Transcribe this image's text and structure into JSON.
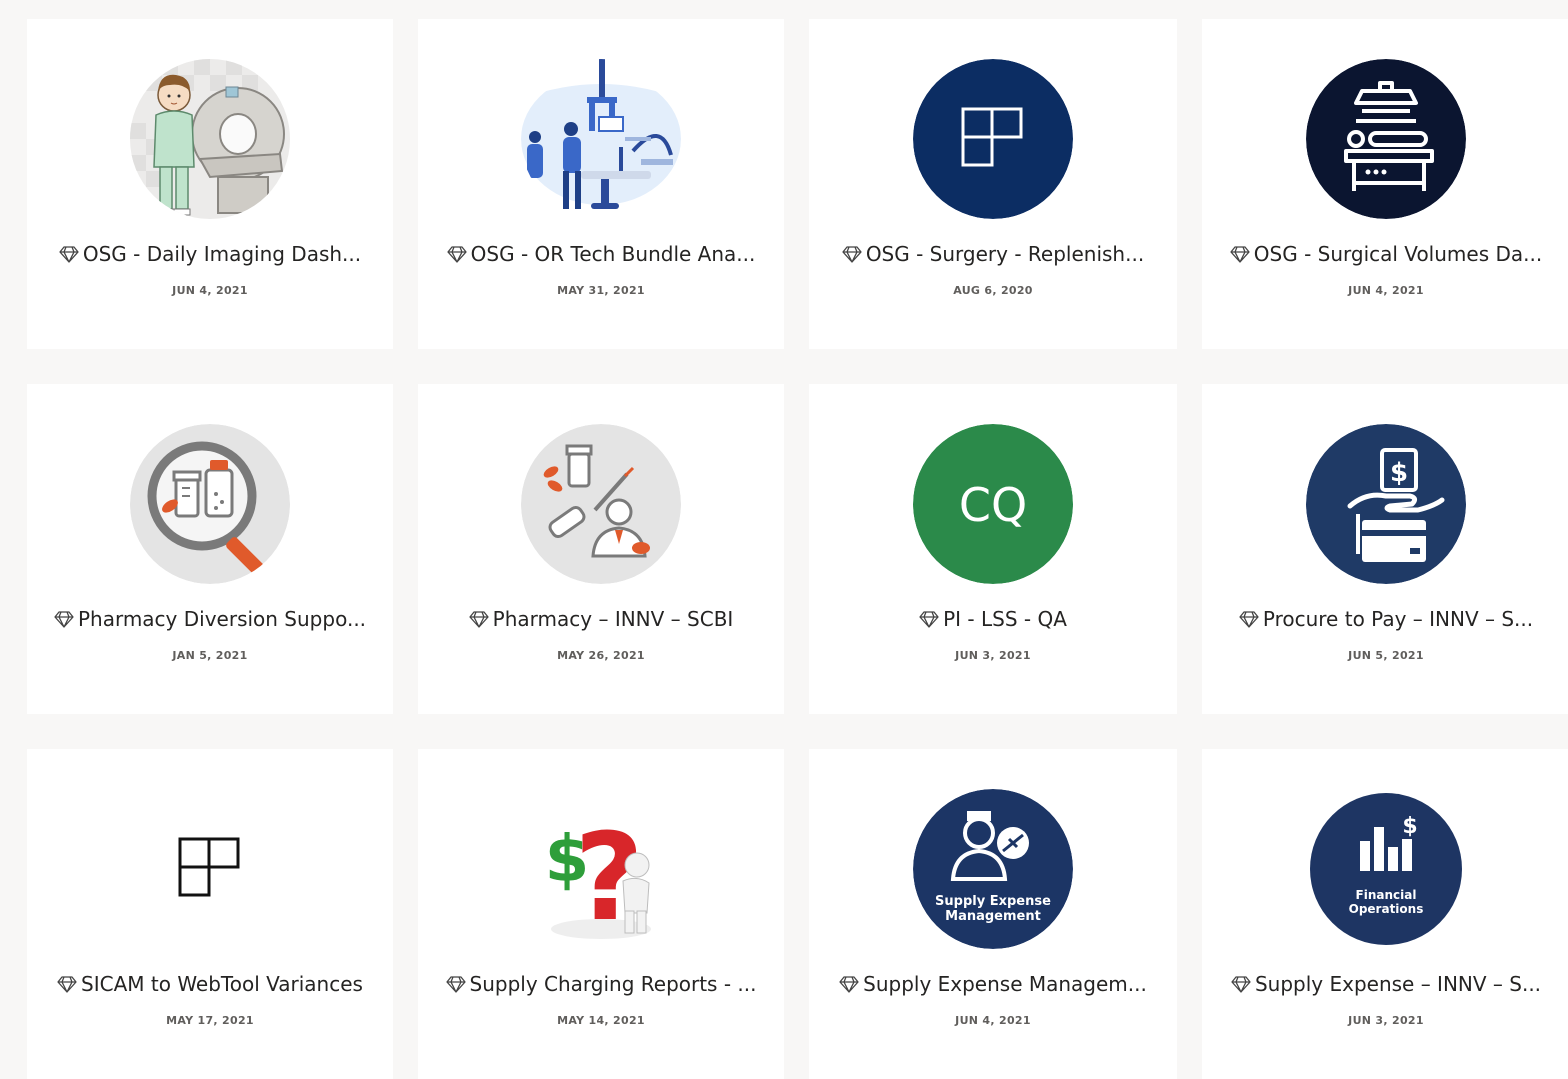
{
  "cards": [
    {
      "title": "OSG - Daily Imaging Dash...",
      "date": "JUN 4, 2021",
      "image": "ct-scanner-technician-illustration"
    },
    {
      "title": "OSG - OR Tech Bundle Ana...",
      "date": "MAY 31, 2021",
      "image": "operating-room-illustration"
    },
    {
      "title": "OSG - Surgery - Replenish...",
      "date": "AUG 6, 2020",
      "image": "app-grid-icon",
      "color": "#0c2d63"
    },
    {
      "title": "OSG - Surgical Volumes Da...",
      "date": "JUN 4, 2021",
      "image": "surgical-table-light-icon",
      "color": "#0b1530"
    },
    {
      "title": "Pharmacy Diversion Suppo...",
      "date": "JAN 5, 2021",
      "image": "magnifier-medication-icon"
    },
    {
      "title": "Pharmacy – INNV – SCBI",
      "date": "MAY 26, 2021",
      "image": "pharmacist-medication-icon"
    },
    {
      "title": "PI - LSS - QA",
      "date": "JUN 3, 2021",
      "image": "initials-avatar",
      "initials": "CQ",
      "color": "#2b8a4a"
    },
    {
      "title": "Procure to Pay – INNV – S...",
      "date": "JUN 5, 2021",
      "image": "hand-payment-icon",
      "color": "#1f3a66"
    },
    {
      "title": "SICAM to WebTool Variances",
      "date": "MAY 17, 2021",
      "image": "app-grid-icon"
    },
    {
      "title": "Supply Charging Reports - ...",
      "date": "MAY 14, 2021",
      "image": "question-dollar-figure-icon"
    },
    {
      "title": "Supply Expense Managem...",
      "date": "JUN 4, 2021",
      "image": "supply-expense-management-logo",
      "logo_text": [
        "Supply Expense",
        "Management"
      ],
      "color": "#1c3565"
    },
    {
      "title": "Supply Expense – INNV – S...",
      "date": "JUN 3, 2021",
      "image": "financial-operations-logo",
      "logo_text": [
        "Financial",
        "Operations"
      ],
      "color": "#1e3563"
    }
  ]
}
